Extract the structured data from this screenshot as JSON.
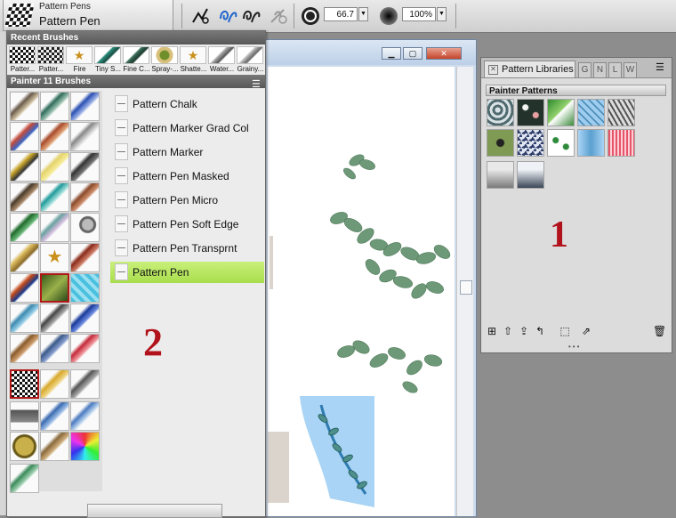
{
  "property_bar": {
    "category_name": "Pattern Pens",
    "variant_name": "Pattern Pen",
    "size_value": "66.7",
    "opacity_value": "100%"
  },
  "recent_brushes": {
    "header": "Recent Brushes",
    "items": [
      "Patter...",
      "Patter...",
      "Fire",
      "Tiny S...",
      "Fine C...",
      "Spray-...",
      "Shatte...",
      "Water...",
      "Grainy..."
    ]
  },
  "painter_brushes": {
    "header": "Painter 11 Brushes",
    "variants": [
      "Pattern Chalk",
      "Pattern Marker Grad Col",
      "Pattern Marker",
      "Pattern Pen Masked",
      "Pattern Pen Micro",
      "Pattern Pen Soft Edge",
      "Pattern Pen Transprnt",
      "Pattern Pen"
    ],
    "selected_variant": "Pattern Pen"
  },
  "palette": {
    "tab_label": "Pattern Libraries",
    "mini_tabs": [
      "G",
      "N",
      "L",
      "W"
    ],
    "library_header": "Painter Patterns"
  },
  "annotations": {
    "one": "1",
    "two": "2"
  },
  "colors": {
    "accent_green": "#b4e35c",
    "annotation_red": "#b1121b",
    "header_gray": "#666666"
  }
}
